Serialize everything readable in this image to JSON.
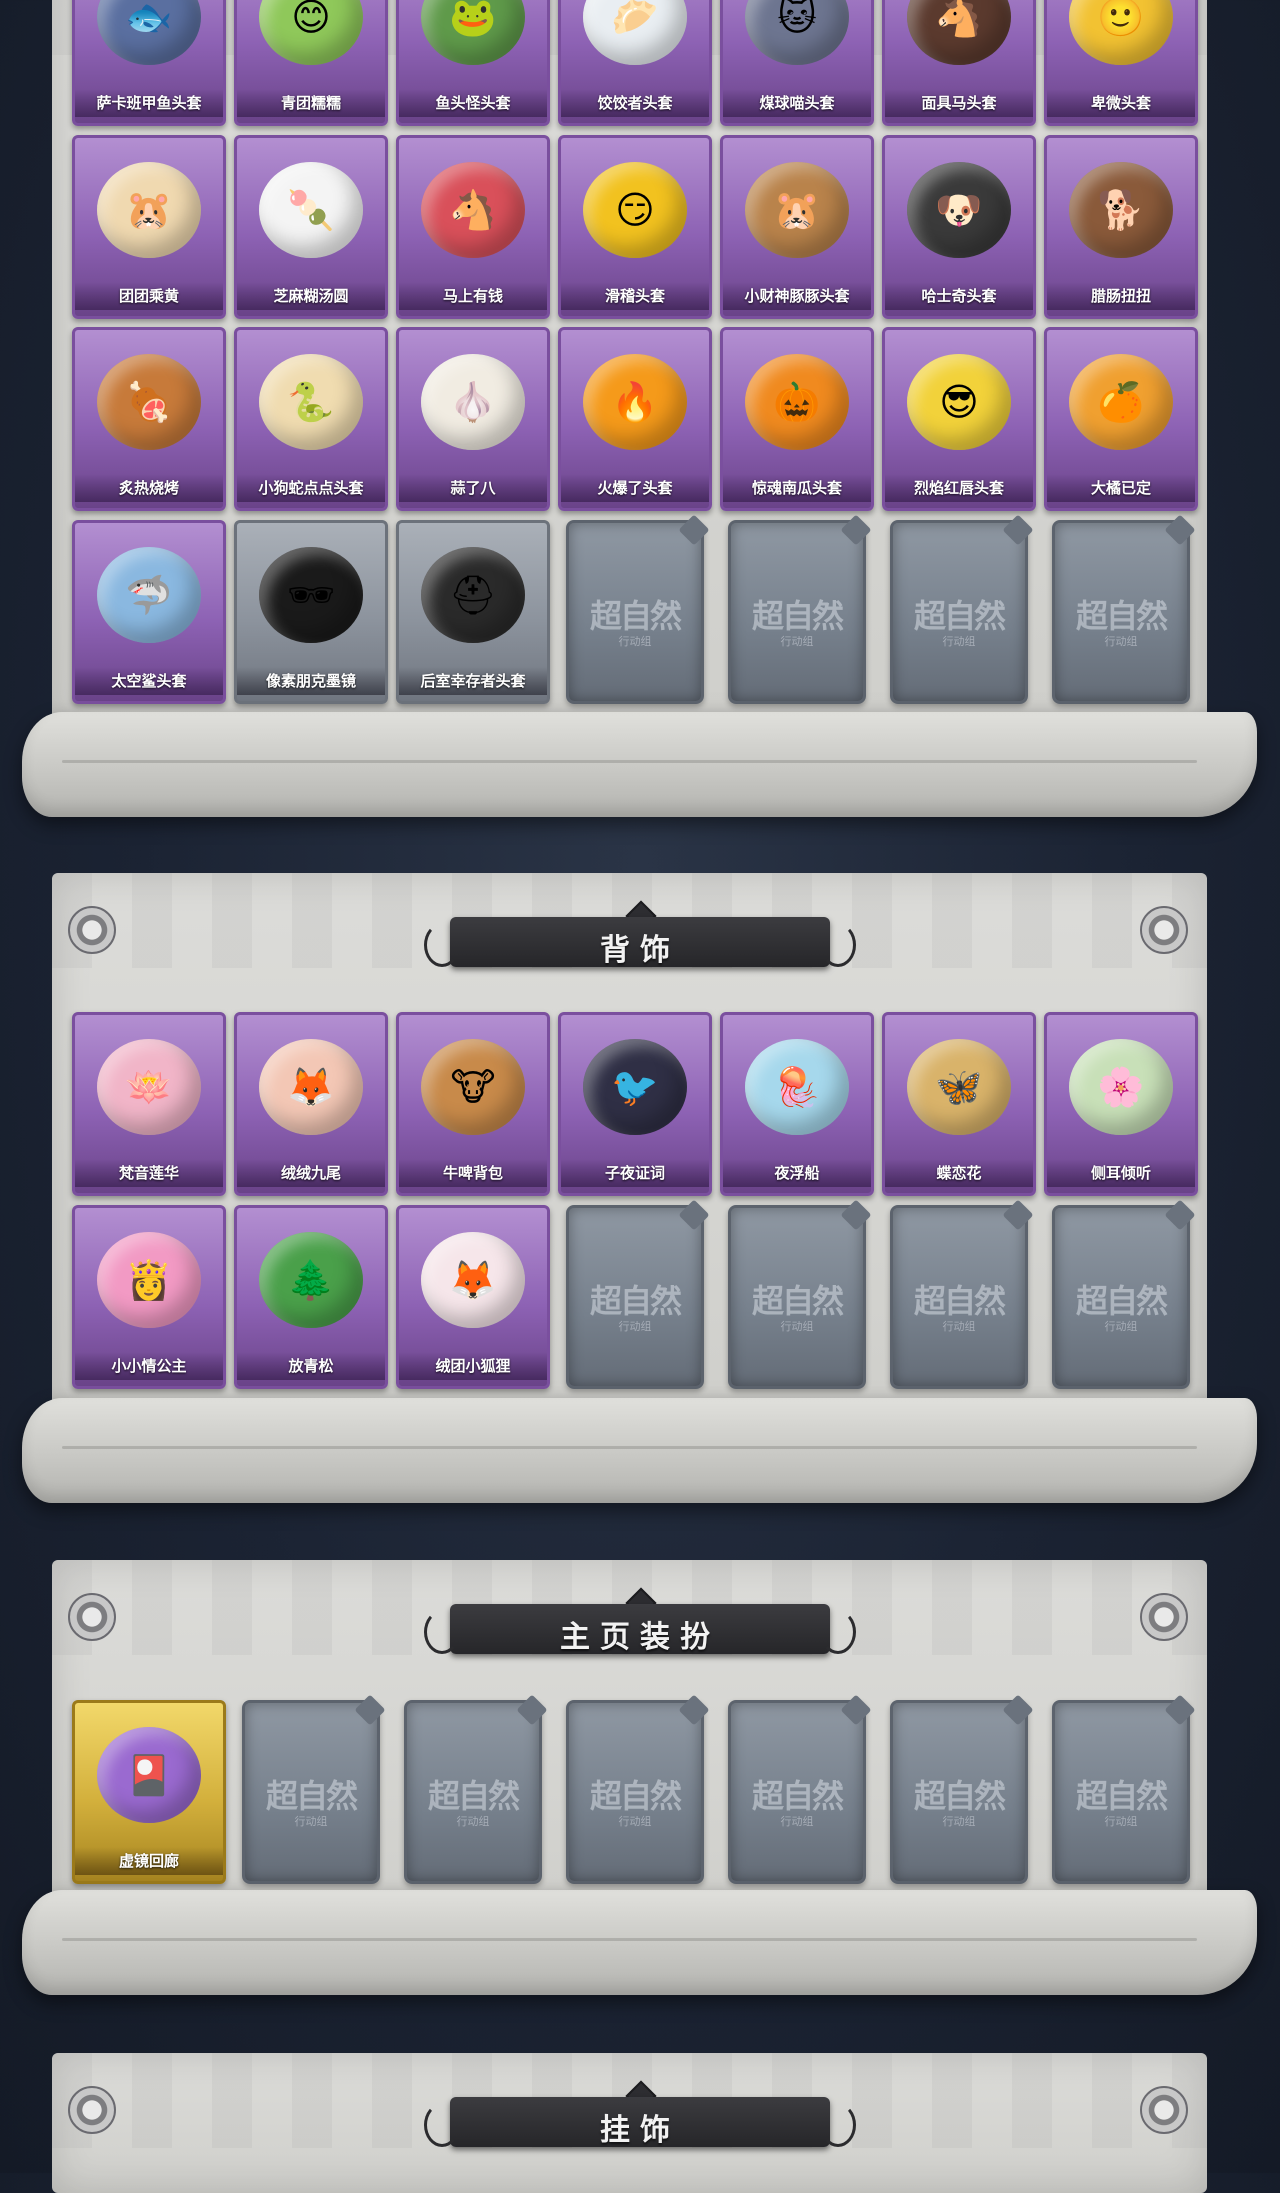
{
  "watermark": {
    "main": "超自然",
    "sub": "行动组"
  },
  "colors": {
    "purple_card": "#8d62b4",
    "gray_card": "#8c939d",
    "gold_card": "#d3b03c",
    "banner": "#2b2b2e"
  },
  "sections": {
    "headwear": {
      "rows": [
        [
          {
            "label": "萨卡班甲鱼头套",
            "tone": "purple",
            "icon": "fish-head-icon",
            "color": "#5a6fa0",
            "glyph": "🐟"
          },
          {
            "label": "青团糯糯",
            "tone": "purple",
            "icon": "green-dumpling-icon",
            "color": "#8fc85a",
            "glyph": "😊"
          },
          {
            "label": "鱼头怪头套",
            "tone": "purple",
            "icon": "fish-monster-icon",
            "color": "#5f9a4a",
            "glyph": "🐸"
          },
          {
            "label": "饺饺者头套",
            "tone": "purple",
            "icon": "dumpling-head-icon",
            "color": "#e9eef2",
            "glyph": "🥟"
          },
          {
            "label": "煤球喵头套",
            "tone": "purple",
            "icon": "cat-head-icon",
            "color": "#6d7590",
            "glyph": "🐱"
          },
          {
            "label": "面具马头套",
            "tone": "purple",
            "icon": "horse-mask-icon",
            "color": "#5b3a2e",
            "glyph": "🐴"
          },
          {
            "label": "卑微头套",
            "tone": "purple",
            "icon": "humble-face-icon",
            "color": "#f2c232",
            "glyph": "🙂"
          }
        ],
        [
          {
            "label": "团团乘黄",
            "tone": "purple",
            "icon": "hamster-icon",
            "color": "#f0d9b0",
            "glyph": "🐹"
          },
          {
            "label": "芝麻糊汤圆",
            "tone": "purple",
            "icon": "rice-ball-icon",
            "color": "#f4f4f4",
            "glyph": "🍡"
          },
          {
            "label": "马上有钱",
            "tone": "purple",
            "icon": "red-horse-icon",
            "color": "#d9505a",
            "glyph": "🐴"
          },
          {
            "label": "滑稽头套",
            "tone": "purple",
            "icon": "funny-face-icon",
            "color": "#f2c21f",
            "glyph": "😏"
          },
          {
            "label": "小财神豚豚头套",
            "tone": "purple",
            "icon": "capybara-icon",
            "color": "#b9834b",
            "glyph": "🐹"
          },
          {
            "label": "哈士奇头套",
            "tone": "purple",
            "icon": "husky-icon",
            "color": "#3a3a3a",
            "glyph": "🐶"
          },
          {
            "label": "腊肠扭扭",
            "tone": "purple",
            "icon": "dachshund-icon",
            "color": "#8a5a3a",
            "glyph": "🐕"
          }
        ],
        [
          {
            "label": "炙热烧烤",
            "tone": "purple",
            "icon": "bbq-meat-icon",
            "color": "#c77a3a",
            "glyph": "🍖"
          },
          {
            "label": "小狗蛇点点头套",
            "tone": "purple",
            "icon": "snake-icon",
            "color": "#f0dcb0",
            "glyph": "🐍"
          },
          {
            "label": "蒜了八",
            "tone": "purple",
            "icon": "garlic-icon",
            "color": "#f1ece2",
            "glyph": "🧄"
          },
          {
            "label": "火爆了头套",
            "tone": "purple",
            "icon": "fire-icon",
            "color": "#f59a1a",
            "glyph": "🔥"
          },
          {
            "label": "惊魂南瓜头套",
            "tone": "purple",
            "icon": "pumpkin-icon",
            "color": "#f08a1f",
            "glyph": "🎃"
          },
          {
            "label": "烈焰红唇头套",
            "tone": "purple",
            "icon": "sunglasses-pikachu-icon",
            "color": "#f2d23a",
            "glyph": "😎"
          },
          {
            "label": "大橘已定",
            "tone": "purple",
            "icon": "orange-icon",
            "color": "#f0a030",
            "glyph": "🍊"
          }
        ],
        [
          {
            "label": "太空鲨头套",
            "tone": "purple",
            "icon": "shark-icon",
            "color": "#8ab8e0",
            "glyph": "🦈"
          },
          {
            "label": "像素朋克墨镜",
            "tone": "gray",
            "icon": "pixel-sunglasses-icon",
            "color": "#1a1a1a",
            "glyph": "🕶"
          },
          {
            "label": "后室幸存者头套",
            "tone": "gray",
            "icon": "gas-mask-icon",
            "color": "#2a2a2a",
            "glyph": "⛑"
          }
        ]
      ],
      "empty_count": 4
    },
    "back": {
      "title": "背饰",
      "rows": [
        [
          {
            "label": "梵音莲华",
            "tone": "purple",
            "icon": "lotus-doll-icon",
            "color": "#f1b5c8",
            "glyph": "🪷"
          },
          {
            "label": "绒绒九尾",
            "tone": "purple",
            "icon": "nine-tail-fox-icon",
            "color": "#f3c7b5",
            "glyph": "🦊"
          },
          {
            "label": "牛啤背包",
            "tone": "purple",
            "icon": "cow-barrel-icon",
            "color": "#c88a4a",
            "glyph": "🐮"
          },
          {
            "label": "子夜证词",
            "tone": "purple",
            "icon": "crow-icon",
            "color": "#2f2f45",
            "glyph": "🐦"
          },
          {
            "label": "夜浮船",
            "tone": "purple",
            "icon": "jellyfish-icon",
            "color": "#a6d8ec",
            "glyph": "🪼"
          },
          {
            "label": "蝶恋花",
            "tone": "purple",
            "icon": "butterfly-bell-icon",
            "color": "#d9b36a",
            "glyph": "🦋"
          },
          {
            "label": "侧耳倾听",
            "tone": "purple",
            "icon": "flower-ring-icon",
            "color": "#c8e0b8",
            "glyph": "🌸"
          }
        ],
        [
          {
            "label": "小小情公主",
            "tone": "purple",
            "icon": "princess-icon",
            "color": "#f29ac4",
            "glyph": "👸"
          },
          {
            "label": "放青松",
            "tone": "purple",
            "icon": "pine-bonsai-icon",
            "color": "#4aa04a",
            "glyph": "🌲"
          },
          {
            "label": "绒团小狐狸",
            "tone": "purple",
            "icon": "small-fox-icon",
            "color": "#f6e6ea",
            "glyph": "🦊"
          }
        ]
      ],
      "empty_count": 4
    },
    "homepage": {
      "title": "主页装扮",
      "rows": [
        [
          {
            "label": "虚镜回廊",
            "tone": "gold",
            "icon": "card-frame-icon",
            "color": "#9a6ad0",
            "glyph": "🎴"
          }
        ]
      ],
      "empty_count": 6
    },
    "pendant": {
      "title": "挂饰"
    }
  }
}
